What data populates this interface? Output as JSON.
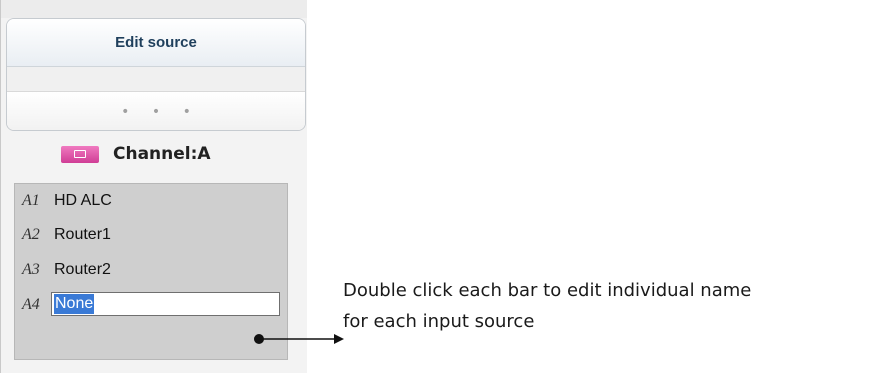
{
  "panel": {
    "title": "Edit source",
    "dots": "• • •",
    "channel_label": "Channel:A"
  },
  "sources": [
    {
      "id": "A1",
      "name": "HD ALC"
    },
    {
      "id": "A2",
      "name": "Router1"
    },
    {
      "id": "A3",
      "name": "Router2"
    },
    {
      "id": "A4",
      "name": "None",
      "editing": true
    }
  ],
  "annotation": {
    "line1": "Double click each bar to edit individual name",
    "line2": "for each input source"
  },
  "colors": {
    "title": "#1f3f5c",
    "channel_icon": "#e05aaa",
    "selection": "#3a7ad6"
  },
  "icons": {
    "channel": "pink-monitor-icon",
    "arrow": "right-arrow-icon"
  }
}
